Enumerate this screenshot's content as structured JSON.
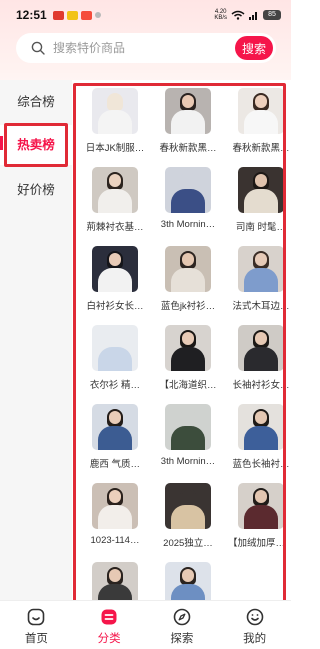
{
  "status_bar": {
    "time": "12:51",
    "net_speed_value": "4.20",
    "net_speed_unit": "KB/s",
    "battery": "85"
  },
  "search": {
    "placeholder": "搜索特价商品",
    "button_label": "搜索"
  },
  "sidebar": {
    "items": [
      {
        "label": "综合榜"
      },
      {
        "label": "热卖榜"
      },
      {
        "label": "好价榜"
      }
    ],
    "active_index": 1
  },
  "products": [
    {
      "title": "日本JK制服…",
      "bg": "#e9e9ee",
      "top": "#f4f4f4",
      "hair": "#f0e6d8",
      "face": "#f0e6d8"
    },
    {
      "title": "春秋新款黑…",
      "bg": "#b8b3b0",
      "top": "#f2f2f2",
      "hair": "#2a2220",
      "face": "#e9c9b4"
    },
    {
      "title": "春秋新款黑…",
      "bg": "#ece8e4",
      "top": "#f7f7f7",
      "hair": "#3a2a22",
      "face": "#edd0bd"
    },
    {
      "title": "荊棘衬衣基…",
      "bg": "#cfc9c2",
      "top": "#f1efec",
      "hair": "#2b231e",
      "face": "#ead2bf"
    },
    {
      "title": "3th Mornin…",
      "bg": "#cfd3dc",
      "top": "#3b4f86",
      "hair": "#cfd3dc",
      "face": "#cfd3dc"
    },
    {
      "title": "司南 时髦…",
      "bg": "#3a3330",
      "top": "#e4dccf",
      "hair": "#1e1916",
      "face": "#e0c3ad"
    },
    {
      "title": "白衬衫女长…",
      "bg": "#2b2e3c",
      "top": "#f2f2f2",
      "hair": "#15151a",
      "face": "#e8cbb7"
    },
    {
      "title": "蓝色jk衬衫…",
      "bg": "#c9bfb4",
      "top": "#e6e0d8",
      "hair": "#2d2521",
      "face": "#e4c7b1"
    },
    {
      "title": "法式木耳边…",
      "bg": "#d8d2cc",
      "top": "#7e9ccc",
      "hair": "#3a2d26",
      "face": "#e6cbb8"
    },
    {
      "title": "衣尔衫 精…",
      "bg": "#e9ecf0",
      "top": "#c9d6e8",
      "hair": "#e9ecf0",
      "face": "#e9ecf0"
    },
    {
      "title": "【北海道织…",
      "bg": "#d7d3cf",
      "top": "#1f1f22",
      "hair": "#1a1715",
      "face": "#e7cab6"
    },
    {
      "title": "长袖衬衫女…",
      "bg": "#cfcbc6",
      "top": "#2a2a2e",
      "hair": "#1c1916",
      "face": "#e6c9b4"
    },
    {
      "title": "鹿西 气质…",
      "bg": "#d5dbe4",
      "top": "#3c5c92",
      "hair": "#231d19",
      "face": "#e8ccb8"
    },
    {
      "title": "3th Mornin…",
      "bg": "#cfd2cf",
      "top": "#3c4d3c",
      "hair": "#cfd2cf",
      "face": "#cfd2cf"
    },
    {
      "title": "蓝色长袖衬…",
      "bg": "#e4e1dd",
      "top": "#3d5f9a",
      "hair": "#1e1a17",
      "face": "#e4c8b3"
    },
    {
      "title": "1023-114…",
      "bg": "#cbbfb5",
      "top": "#f2eeea",
      "hair": "#2a211c",
      "face": "#ebcfbb"
    },
    {
      "title": "2025独立…",
      "bg": "#3a3432",
      "top": "#d8c3a3",
      "hair": "#3a3432",
      "face": "#3a3432"
    },
    {
      "title": "【加绒加厚】…",
      "bg": "#d6d0ca",
      "top": "#5b2a2f",
      "hair": "#211c19",
      "face": "#e3c6b1"
    },
    {
      "title": "",
      "bg": "#d2cdc8",
      "top": "#3a3a3a",
      "hair": "#2a231f",
      "face": "#e6c9b4"
    },
    {
      "title": "",
      "bg": "#dde2ea",
      "top": "#6d8fc2",
      "hair": "#2a231f",
      "face": "#e6c9b4"
    }
  ],
  "tabbar": {
    "tabs": [
      {
        "label": "首页"
      },
      {
        "label": "分类"
      },
      {
        "label": "探索"
      },
      {
        "label": "我的"
      }
    ],
    "active_index": 1
  },
  "colors": {
    "accent": "#f5154a",
    "highlight_box": "#e02a36"
  }
}
